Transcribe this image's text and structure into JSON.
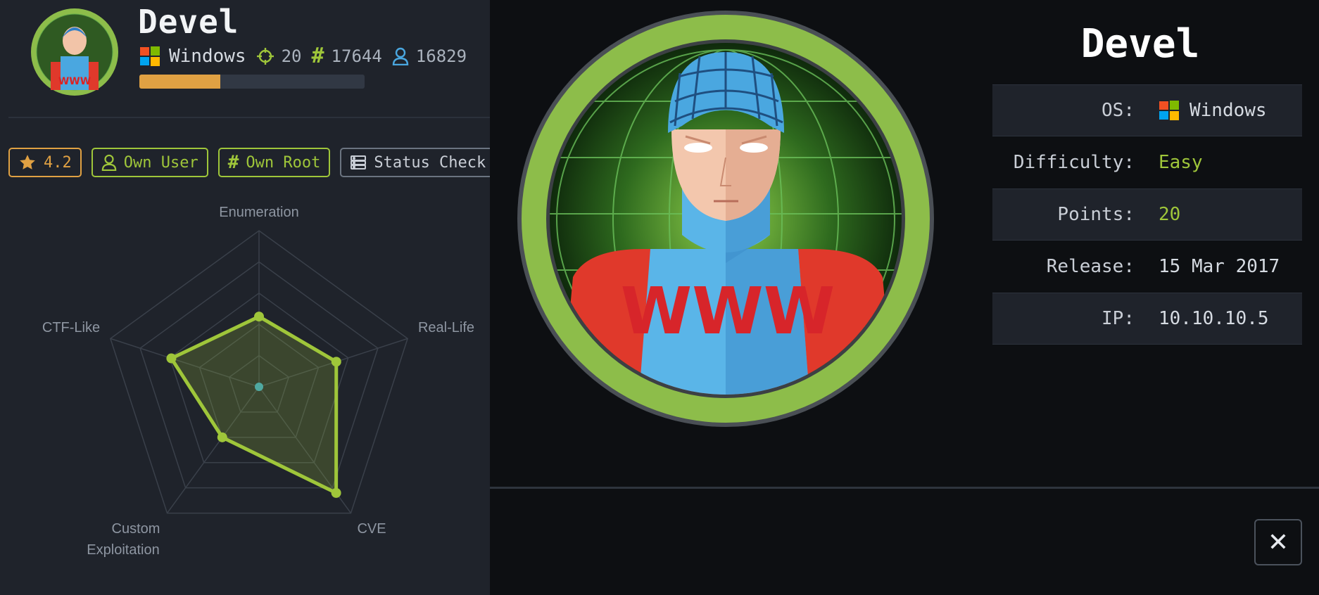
{
  "machine": {
    "name": "Devel",
    "os": "Windows",
    "points": "20",
    "rank": "17644",
    "user_owns": "16829",
    "progress_fraction": 0.36,
    "avatar_text": "WWW"
  },
  "actions": {
    "rating": "4.2",
    "own_user": "Own User",
    "own_root": "Own Root",
    "status_check": "Status Check"
  },
  "radar": {
    "axes": [
      "Enumeration",
      "Real-Life",
      "CVE",
      "Custom Exploitation",
      "CTF-Like"
    ],
    "axis_label_lines": {
      "custom_line1": "Custom",
      "custom_line2": "Exploitation"
    },
    "values": [
      0.45,
      0.52,
      0.84,
      0.4,
      0.59
    ],
    "color": "#9fc63a"
  },
  "modal": {
    "title": "Devel",
    "rows": [
      {
        "key": "OS:",
        "value": "Windows"
      },
      {
        "key": "Difficulty:",
        "value": "Easy"
      },
      {
        "key": "Points:",
        "value": "20"
      },
      {
        "key": "Release:",
        "value": "15 Mar 2017"
      },
      {
        "key": "IP:",
        "value": "10.10.10.5"
      }
    ],
    "close_label": "✕"
  },
  "colors": {
    "accent_green": "#9fc63a",
    "accent_orange": "#e0a143",
    "modal_bg": "#0d0f12",
    "page_bg": "#1f232b"
  }
}
